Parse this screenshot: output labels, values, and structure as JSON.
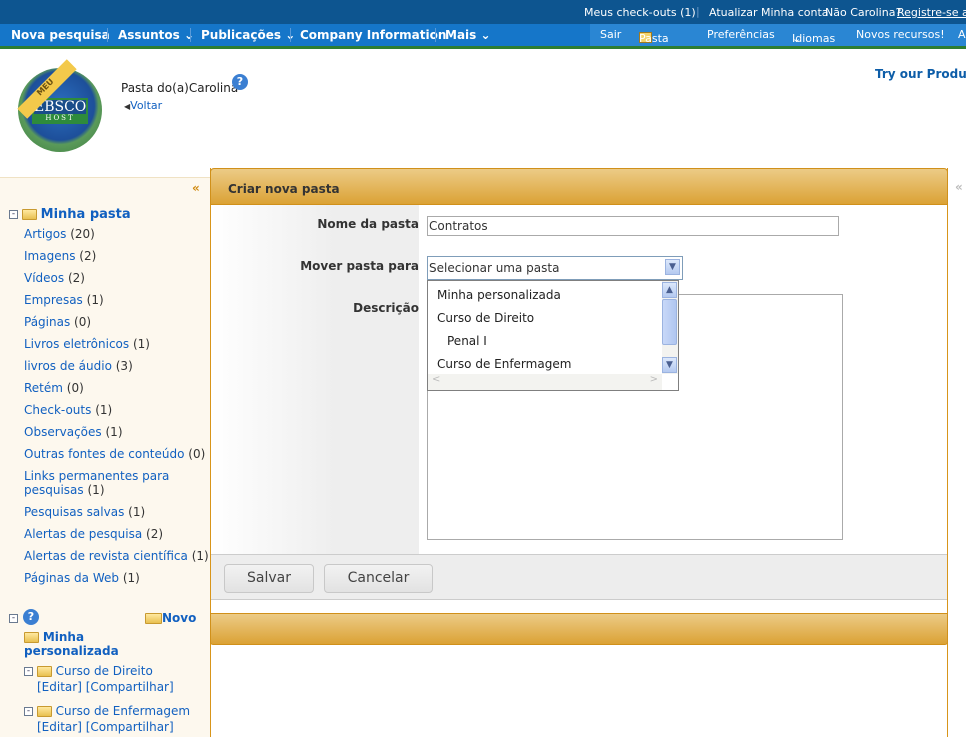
{
  "topbar": {
    "checkouts": "Meus check-outs (1)",
    "update_account": "Atualizar Minha conta",
    "not_user": "Não Carolina?",
    "register": "Registre-se aqui"
  },
  "nav": {
    "items": [
      "Nova pesquisa",
      "Assuntos",
      "Publicações",
      "Company Information",
      "Mais"
    ],
    "right": [
      "Sair",
      "Pasta",
      "Preferências",
      "Idiomas",
      "Novos recursos!",
      "A"
    ]
  },
  "header": {
    "logo_text": "EBSCO HOST",
    "logo_banner": "MEU",
    "title": "Pasta do(a)Carolina",
    "back": "Voltar",
    "promo": "Try our Products"
  },
  "sidebar": {
    "collapse": "«",
    "root": "Minha pasta",
    "items": [
      {
        "label": "Artigos",
        "count": "(20)"
      },
      {
        "label": "Imagens",
        "count": "(2)"
      },
      {
        "label": "Vídeos",
        "count": "(2)"
      },
      {
        "label": "Empresas",
        "count": "(1)"
      },
      {
        "label": "Páginas",
        "count": "(0)"
      },
      {
        "label": "Livros eletrônicos",
        "count": "(1)"
      },
      {
        "label": "livros de áudio",
        "count": "(3)"
      },
      {
        "label": "Retém",
        "count": "(0)"
      },
      {
        "label": "Check-outs",
        "count": "(1)"
      },
      {
        "label": "Observações",
        "count": "(1)"
      },
      {
        "label": "Outras fontes de conteúdo",
        "count": "(0)"
      },
      {
        "label": "Links permanentes para pesquisas",
        "count": "(1)"
      },
      {
        "label": "Pesquisas salvas",
        "count": "(1)"
      },
      {
        "label": "Alertas de pesquisa",
        "count": "(2)"
      },
      {
        "label": "Alertas de revista científica",
        "count": "(1)"
      },
      {
        "label": "Páginas da Web",
        "count": "(1)"
      }
    ],
    "new_label": "Novo",
    "custom_root": "Minha personalizada",
    "folders": [
      {
        "name": "Curso de Direito",
        "edit": "[Editar]",
        "share": "[Compartilhar]"
      },
      {
        "name": "Curso de Enfermagem",
        "edit": "[Editar]",
        "share": "[Compartilhar]"
      }
    ]
  },
  "form": {
    "title": "Criar nova pasta",
    "name_label": "Nome da pasta",
    "name_value": "Contratos",
    "move_label": "Mover pasta para",
    "move_value": "Selecionar uma pasta",
    "options": [
      "Minha personalizada",
      "Curso de Direito",
      "Penal I",
      "Curso de Enfermagem"
    ],
    "desc_label": "Descrição",
    "save": "Salvar",
    "cancel": "Cancelar"
  },
  "right_collapse": "«",
  "colors": {
    "topbar": "#0d5590",
    "nav": "#1576c9",
    "gold": "#dba235",
    "link": "#1160c0"
  }
}
